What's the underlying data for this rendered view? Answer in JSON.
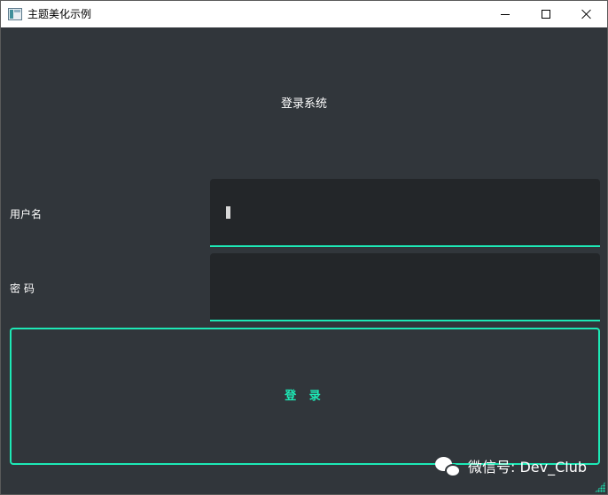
{
  "window": {
    "title": "主题美化示例",
    "icon": "app-icon",
    "controls": [
      "minimize-icon",
      "maximize-icon",
      "close-icon"
    ]
  },
  "form": {
    "heading": "登录系统",
    "username_label": "用户名",
    "username_value": "",
    "password_label": "密 码",
    "password_value": "",
    "login_button": "登 录"
  },
  "watermark": {
    "icon": "wechat-icon",
    "text": "微信号: Dev_Club"
  },
  "colors": {
    "background": "#31363b",
    "input_background": "#232629",
    "accent": "#1de9b6",
    "text": "#ffffff"
  }
}
